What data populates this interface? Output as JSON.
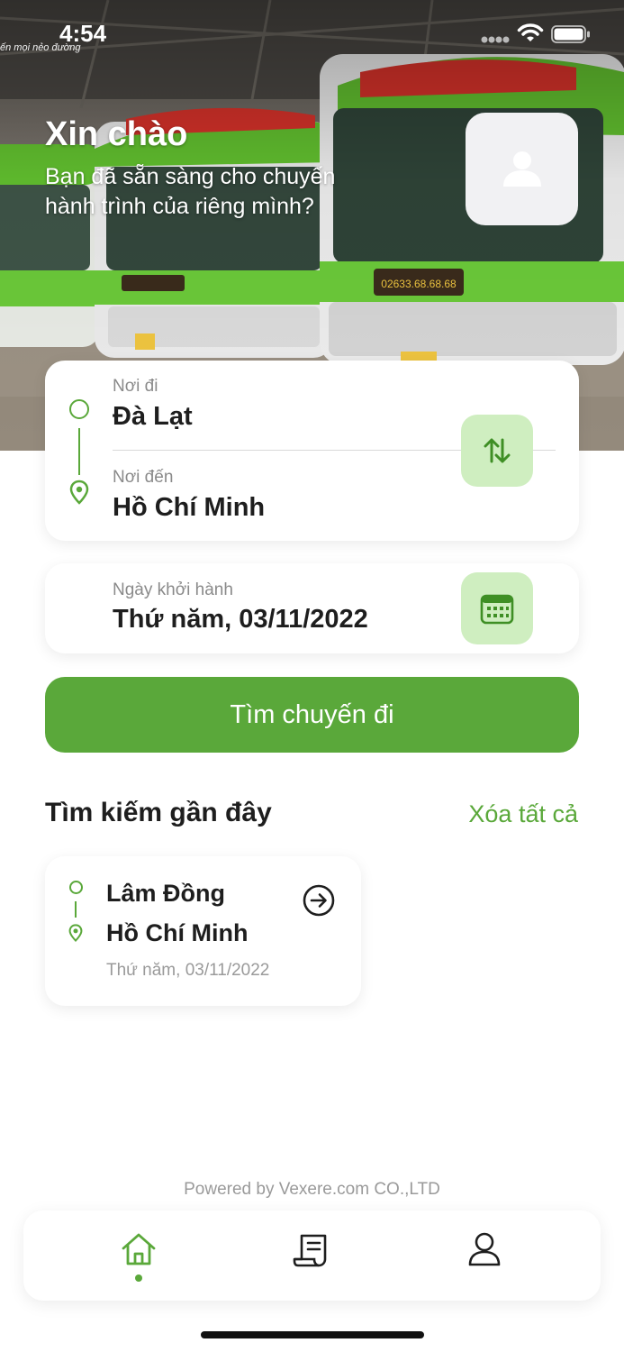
{
  "status_bar": {
    "time": "4:54",
    "watermark": "ến mọi nẻo đường"
  },
  "header": {
    "title": "Xin chào",
    "subtitle": "Bạn đã sẵn sàng cho chuyến hành trình của riêng mình?",
    "avatar_icon": "user-icon"
  },
  "route": {
    "origin_label": "Nơi đi",
    "origin_value": "Đà Lạt",
    "destination_label": "Nơi đến",
    "destination_value": "Hồ Chí Minh",
    "swap_icon": "swap-vertical-icon"
  },
  "departure": {
    "label": "Ngày khởi hành",
    "value": "Thứ năm, 03/11/2022",
    "calendar_icon": "calendar-icon"
  },
  "search_button_label": "Tìm chuyến đi",
  "recent": {
    "title": "Tìm kiếm gần đây",
    "clear_label": "Xóa tất cả",
    "items": [
      {
        "from": "Lâm Đồng",
        "to": "Hồ Chí Minh",
        "date": "Thứ năm, 03/11/2022"
      }
    ]
  },
  "footer": {
    "powered_by": "Powered by Vexere.com CO.,LTD"
  },
  "tabbar": {
    "tabs": [
      {
        "icon": "home-icon",
        "active": true
      },
      {
        "icon": "ticket-icon",
        "active": false
      },
      {
        "icon": "account-icon",
        "active": false
      }
    ]
  },
  "colors": {
    "accent": "#5aa83a",
    "accent_light": "#cfeec0",
    "text": "#1e1e1e",
    "muted": "#8a8a8a"
  }
}
